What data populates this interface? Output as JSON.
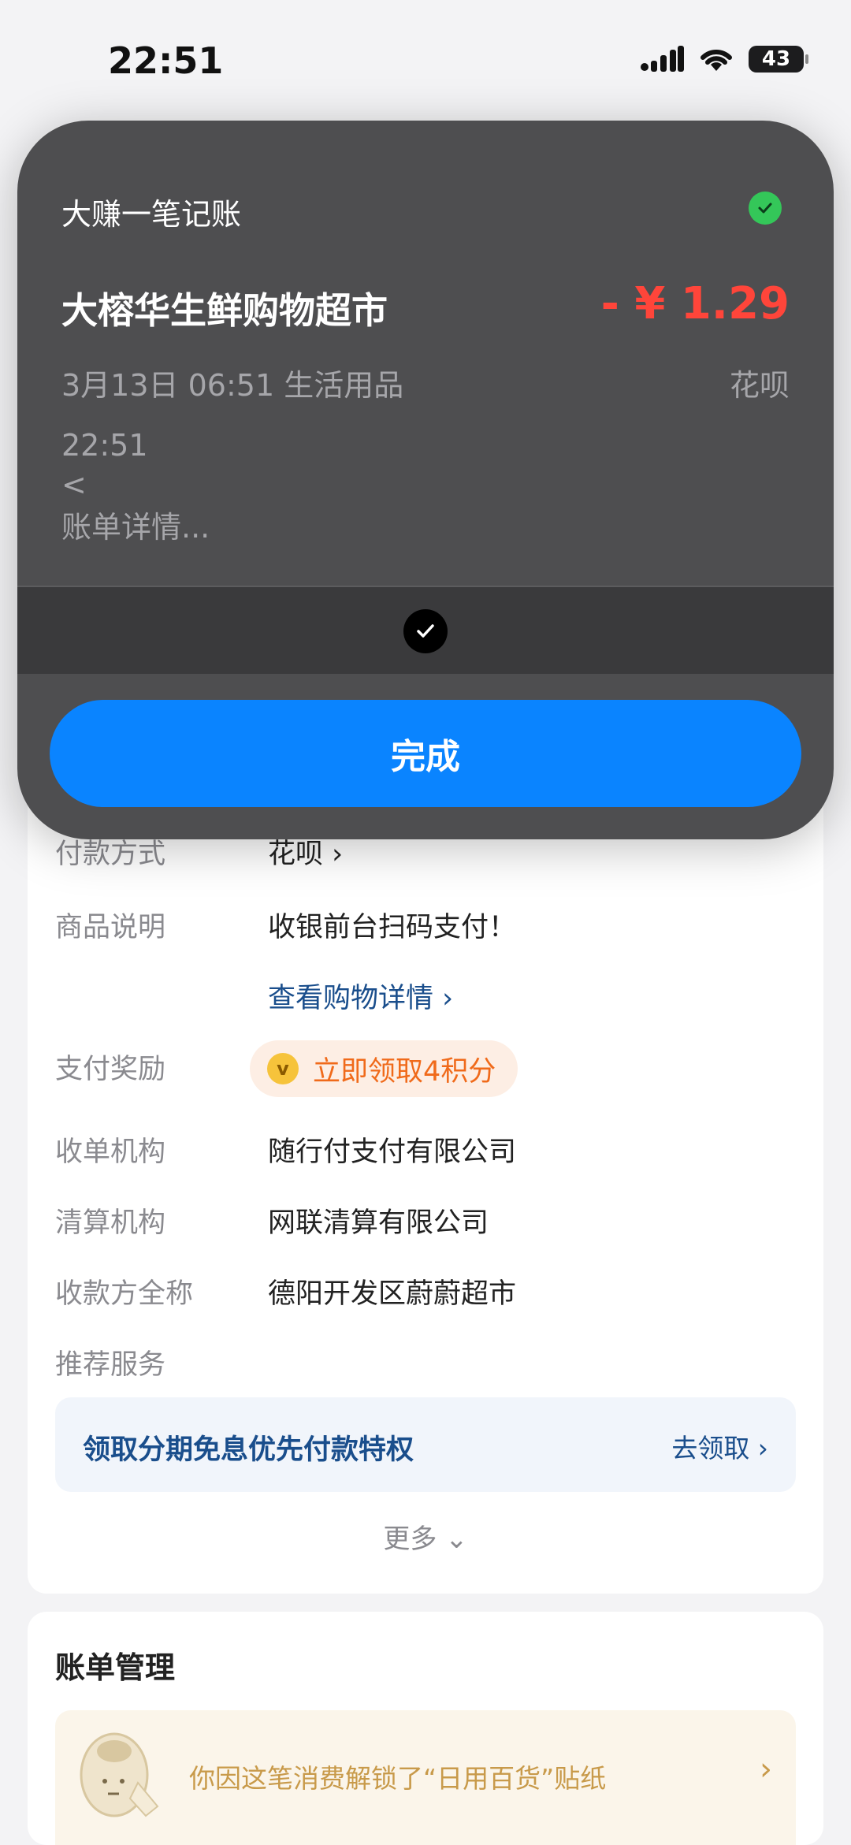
{
  "status_bar": {
    "time": "22:51",
    "battery": "43"
  },
  "detail": {
    "rows": [
      {
        "label": "付款方式",
        "value": "花呗 ›"
      },
      {
        "label": "商品说明",
        "value": "收银前台扫码支付！"
      },
      {
        "label": "",
        "value": "查看购物详情 ›"
      },
      {
        "label": "支付奖励",
        "value": ""
      },
      {
        "label": "收单机构",
        "value": "随行付支付有限公司"
      },
      {
        "label": "清算机构",
        "value": "网联清算有限公司"
      },
      {
        "label": "收款方全称",
        "value": "德阳开发区蔚蔚超市"
      },
      {
        "label": "推荐服务",
        "value": ""
      }
    ],
    "reward": "立即领取4积分",
    "promo_title": "领取分期免息优先付款特权",
    "promo_action": "去领取 ›",
    "more": "更多"
  },
  "bill_management": {
    "title": "账单管理",
    "sticker_text": "你因这笔消费解锁了“日用百货”贴纸"
  },
  "overlay": {
    "app_name": "大赚一笔记账",
    "merchant": "大榕华生鲜购物超市",
    "amount": "- ¥ 1.29",
    "date_category": "3月13日 06:51  生活用品",
    "payment_method": "花呗",
    "line1": "22:51",
    "line2": "<",
    "line3": "账单详情...",
    "done_label": "完成"
  },
  "colors": {
    "accent": "#0a84ff",
    "amount": "#ff453a",
    "success": "#34c759",
    "link": "#1a4e8c",
    "reward": "#f06a1a"
  }
}
